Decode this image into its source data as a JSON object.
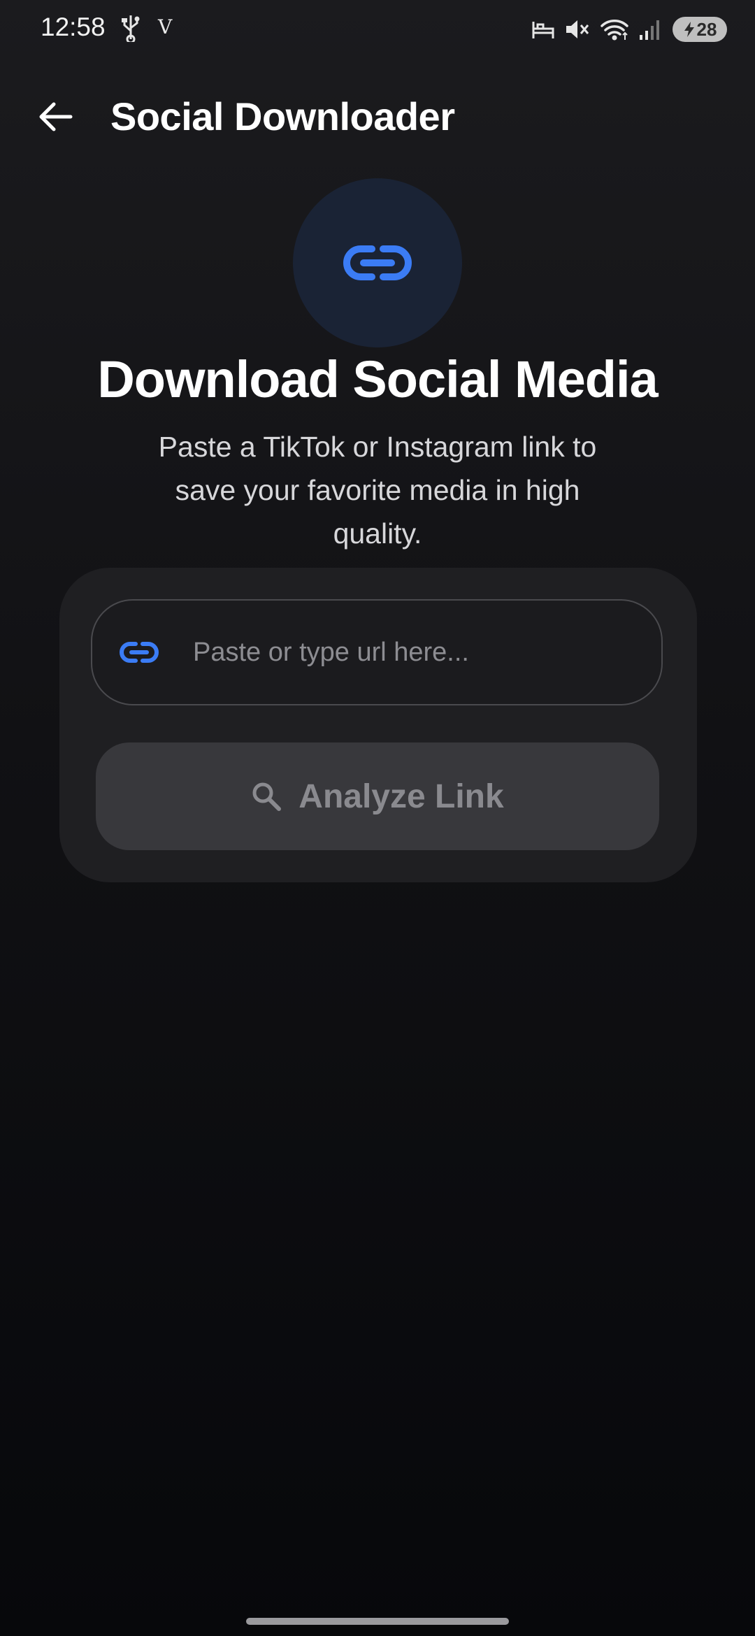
{
  "status_bar": {
    "time": "12:58",
    "carrier_glyph": "V",
    "battery_level": "28",
    "icons": [
      "usb-icon",
      "bed-icon",
      "mute-icon",
      "wifi-icon",
      "signal-icon",
      "battery-icon"
    ]
  },
  "app_bar": {
    "title": "Social Downloader",
    "back_icon": "arrow-left-icon"
  },
  "hero": {
    "icon": "link-icon",
    "title": "Download Social Media",
    "subtitle": "Paste a TikTok or Instagram link to save your favorite media in high quality."
  },
  "url_input": {
    "icon": "link-icon",
    "value": "",
    "placeholder": "Paste or type url here..."
  },
  "analyze_button": {
    "icon": "search-icon",
    "label": "Analyze Link"
  },
  "colors": {
    "accent": "#3b7cf5",
    "hero_circle": "#1a2335",
    "card": "#1f1f22",
    "button_disabled": "#38383c"
  }
}
